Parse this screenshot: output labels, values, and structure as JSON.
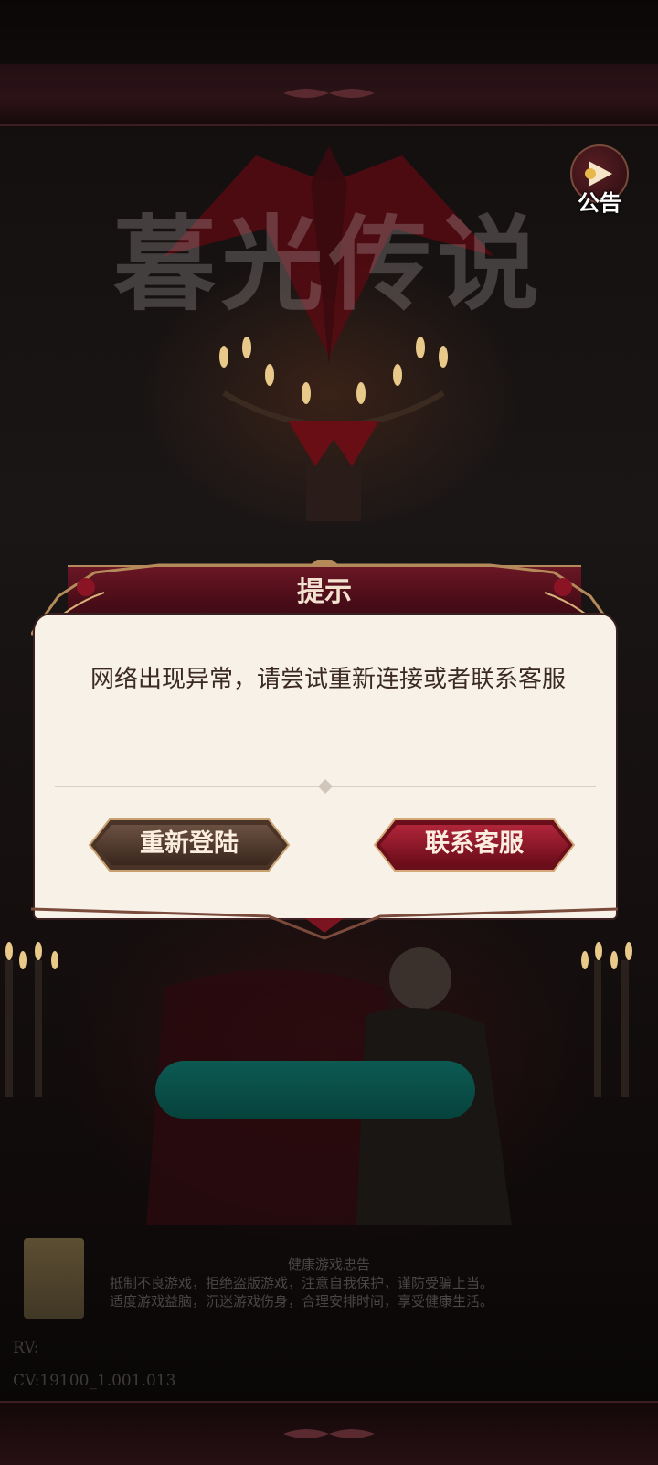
{
  "background": {
    "logo_text": "暮光传说"
  },
  "notice": {
    "label": "公告",
    "icon": "announcement-play-icon"
  },
  "dialog": {
    "title": "提示",
    "message": "网络出现异常，请尝试重新连接或者联系客服",
    "buttons": {
      "relogin": "重新登陆",
      "contact": "联系客服"
    }
  },
  "footer": {
    "health_title": "健康游戏忠告",
    "health_line1": "抵制不良游戏，拒绝盗版游戏，注意自我保护，谨防受骗上当。",
    "health_line2": "适度游戏益脑，沉迷游戏伤身，合理安排时间，享受健康生活。",
    "rv": "RV:",
    "cv": "CV:19100_1.001.013"
  },
  "colors": {
    "dialog_header": "#4a0d18",
    "dialog_body": "#f7f1e8",
    "start_button": "#06423c",
    "accent_gold": "#b58a5a"
  }
}
